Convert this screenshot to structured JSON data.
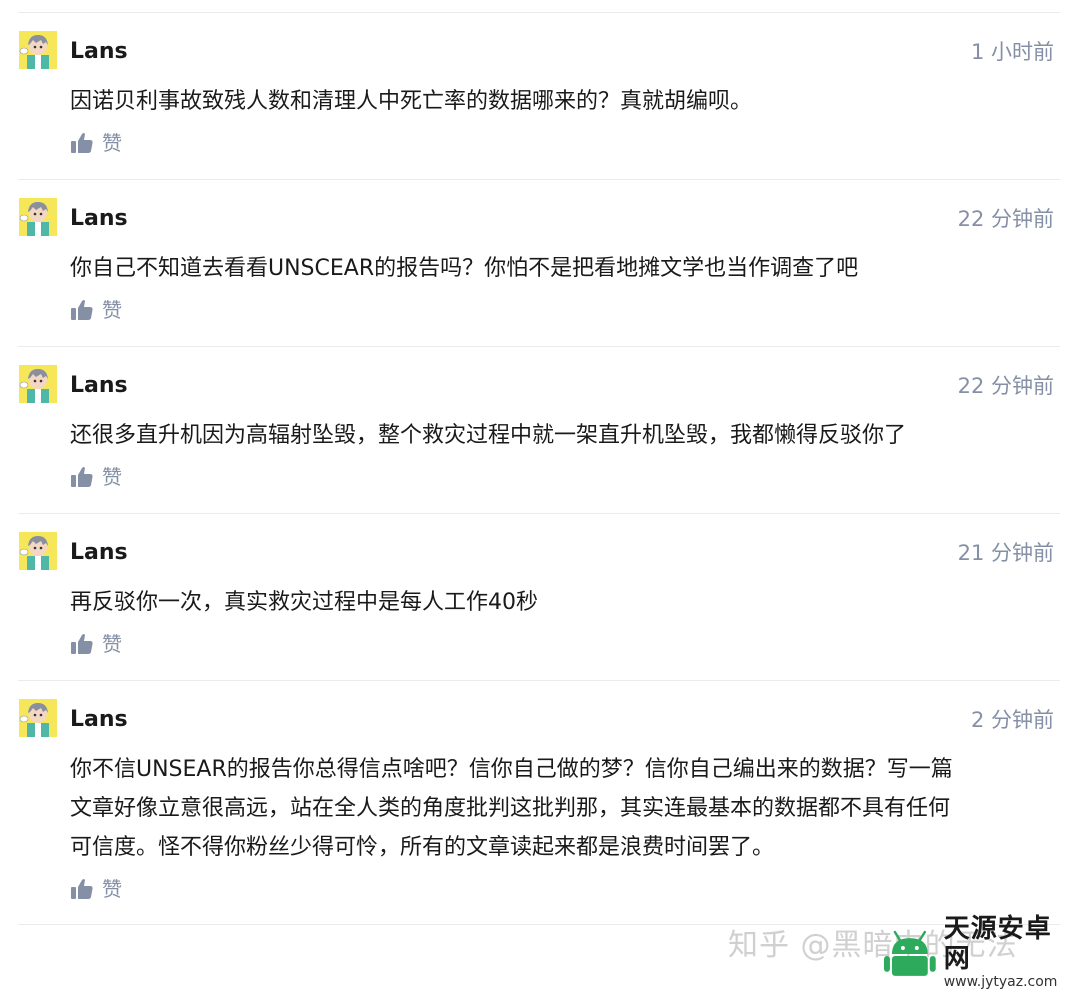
{
  "comments": [
    {
      "author": "Lans",
      "time": "1 小时前",
      "text": "因诺贝利事故致残人数和清理人中死亡率的数据哪来的？真就胡编呗。",
      "like_label": "赞"
    },
    {
      "author": "Lans",
      "time": "22 分钟前",
      "text": "你自己不知道去看看UNSCEAR的报告吗？你怕不是把看地摊文学也当作调查了吧",
      "like_label": "赞"
    },
    {
      "author": "Lans",
      "time": "22 分钟前",
      "text": "还很多直升机因为高辐射坠毁，整个救灾过程中就一架直升机坠毁，我都懒得反驳你了",
      "like_label": "赞"
    },
    {
      "author": "Lans",
      "time": "21 分钟前",
      "text": "再反驳你一次，真实救灾过程中是每人工作40秒",
      "like_label": "赞"
    },
    {
      "author": "Lans",
      "time": "2 分钟前",
      "text_lines": [
        "你不信UNSEAR的报告你总得信点啥吧？信你自己做的梦？信你自己编出来的数据？写一篇",
        "文章好像立意很高远，站在全人类的角度批判这批判那，其实连最基本的数据都不具有任何",
        "可信度。怪不得你粉丝少得可怜，所有的文章读起来都是浪费时间罢了。"
      ],
      "like_label": "赞"
    }
  ],
  "watermark": {
    "text": "知乎 @黑暗中的无法"
  },
  "site_badge": {
    "name": "天源安卓网",
    "url": "www.jytyaz.com"
  },
  "icons": {
    "avatar": "anime-avatar-icon",
    "like": "thumbs-up-icon",
    "site_logo": "android-logo-icon"
  },
  "colors": {
    "meta_gray": "#8590a6",
    "text": "#1a1a1a",
    "divider": "#ebebeb",
    "avatar_bg": "#f6e65a"
  }
}
